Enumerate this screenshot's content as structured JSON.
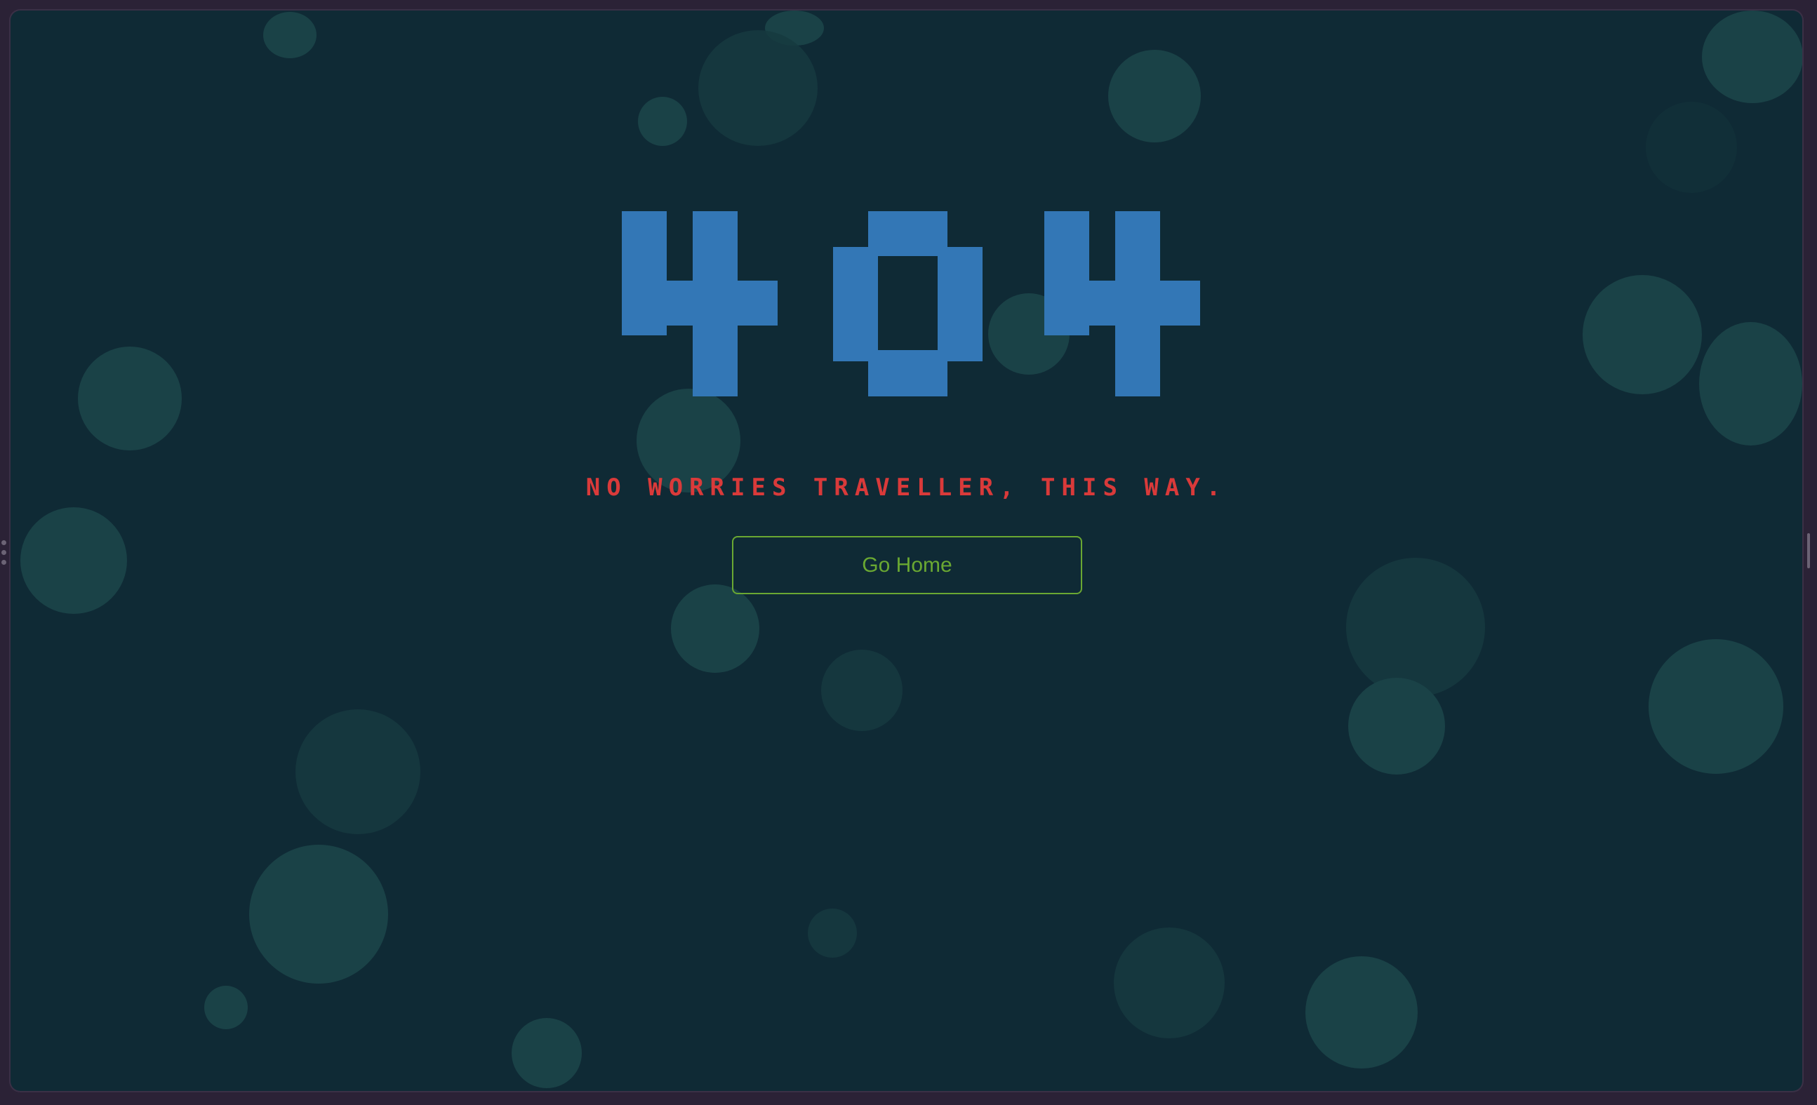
{
  "error_code": "404",
  "message": "No worries traveller, this way.",
  "home_button_label": "Go Home",
  "colors": {
    "background": "#0f2a35",
    "digits": "#3377b6",
    "message": "#d93a3a",
    "button": "#6aa832",
    "bubbles": "#1a4247"
  }
}
